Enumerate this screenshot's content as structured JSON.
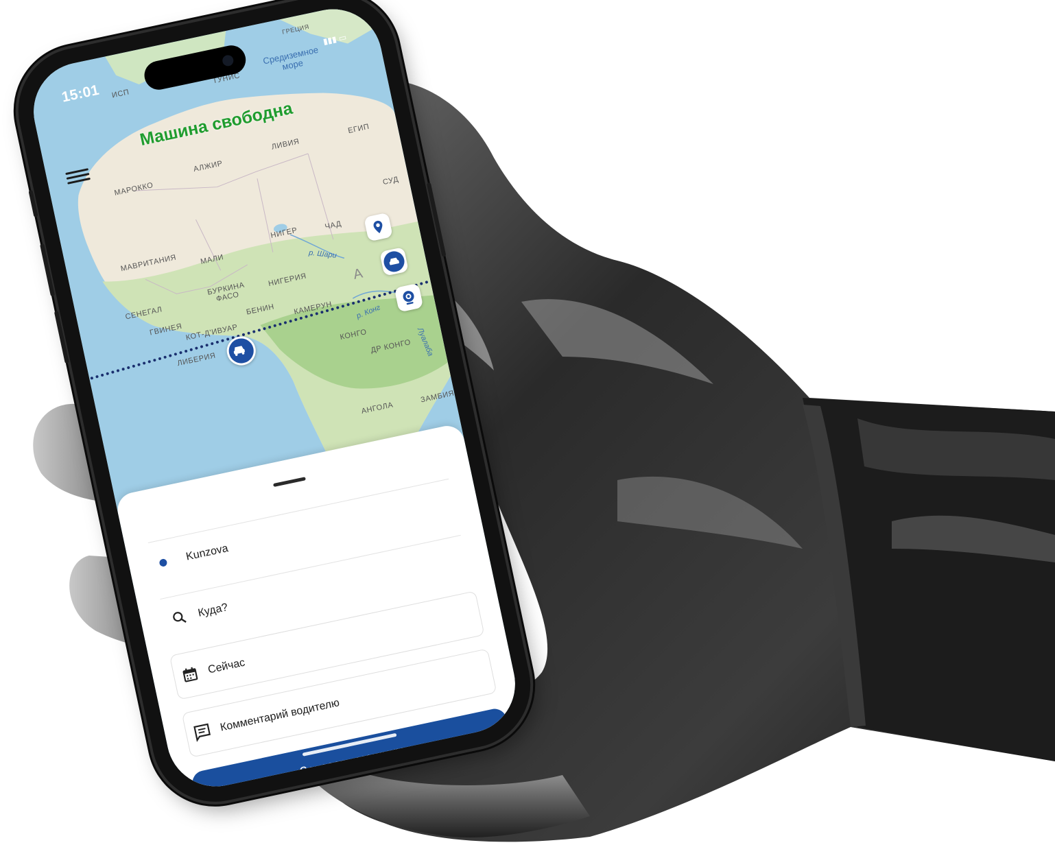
{
  "status_bar": {
    "time": "15:01"
  },
  "app": {
    "status_text": "Машина свободна"
  },
  "map": {
    "labels": {
      "spain": "ИСП",
      "tunisia": "ТУНИС",
      "greece": "ГРЕЦИЯ",
      "med_sea": "Средиземное море",
      "morocco": "МАРОККО",
      "algeria": "АЛЖИР",
      "libya": "ЛИВИЯ",
      "egypt": "ЕГИП",
      "sudan": "СУД",
      "mauritania": "МАВРИТАНИЯ",
      "mali": "МАЛИ",
      "niger": "НИГЕР",
      "chad": "ЧАД",
      "senegal": "СЕНЕГАЛ",
      "burkina": "БУРКИНА ФАСО",
      "nigeria": "НИГЕРИЯ",
      "guinea": "ГВИНЕЯ",
      "ivory_coast": "КОТ-Д'ИВУАР",
      "benin": "БЕНИН",
      "cameroon": "КАМЕРУН",
      "liberia": "ЛИБЕРИЯ",
      "congo": "КОНГО",
      "drc": "ДР КОНГО",
      "angola": "АНГОЛА",
      "zambia": "ЗАМБИЯ",
      "africa": "А",
      "shari_river": "р. Шари",
      "congo_river": "р. Конг",
      "lualaba": "Луалаба"
    }
  },
  "map_buttons": {
    "location": "location-pin-icon",
    "car": "car-icon",
    "camera": "webcam-icon"
  },
  "sheet": {
    "from_value": "Kunzova",
    "to_placeholder": "Куда?",
    "time_value": "Сейчас",
    "comment_placeholder": "Комментарий водителю",
    "order_button": "Заказать машину"
  },
  "colors": {
    "accent": "#1a4f9e",
    "status_free": "#1f9c2e"
  }
}
